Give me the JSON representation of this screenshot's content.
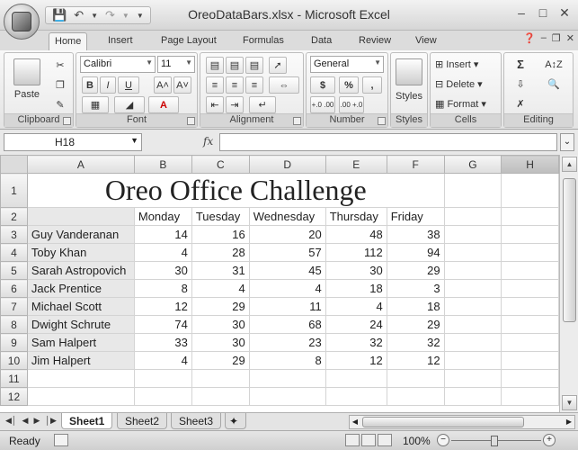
{
  "window": {
    "title": "OreoDataBars.xlsx - Microsoft Excel"
  },
  "qat": {
    "save_icon": "save-icon",
    "undo_icon": "undo-icon",
    "redo_icon": "redo-icon"
  },
  "ribbon": {
    "tabs": [
      "Home",
      "Insert",
      "Page Layout",
      "Formulas",
      "Data",
      "Review",
      "View"
    ],
    "active_tab": "Home",
    "groups": {
      "clipboard": {
        "label": "Clipboard",
        "paste": "Paste"
      },
      "font": {
        "label": "Font",
        "font_name": "Calibri",
        "font_size": "11"
      },
      "alignment": {
        "label": "Alignment"
      },
      "number": {
        "label": "Number",
        "format": "General",
        "currency": "$",
        "percent": "%",
        "comma": ",",
        "inc_dec": "+.0 .00",
        "dec_dec": ".00 +.0"
      },
      "styles": {
        "label": "Styles",
        "button": "Styles"
      },
      "cells": {
        "label": "Cells",
        "insert": "Insert",
        "delete": "Delete",
        "format": "Format"
      },
      "editing": {
        "label": "Editing",
        "sum": "Σ"
      }
    }
  },
  "formula_bar": {
    "name_box": "H18",
    "fx": "fx",
    "formula": ""
  },
  "sheet": {
    "columns": [
      "A",
      "B",
      "C",
      "D",
      "E",
      "F",
      "G",
      "H"
    ],
    "title": "Oreo Office Challenge",
    "headers": [
      "Monday",
      "Tuesday",
      "Wednesday",
      "Thursday",
      "Friday"
    ],
    "rows": [
      {
        "name": "Guy Vanderanan",
        "values": [
          14,
          16,
          20,
          48,
          38
        ]
      },
      {
        "name": "Toby Khan",
        "values": [
          4,
          28,
          57,
          112,
          94
        ]
      },
      {
        "name": "Sarah Astropovich",
        "values": [
          30,
          31,
          45,
          30,
          29
        ]
      },
      {
        "name": "Jack Prentice",
        "values": [
          8,
          4,
          4,
          18,
          3
        ]
      },
      {
        "name": "Michael Scott",
        "values": [
          12,
          29,
          11,
          4,
          18
        ]
      },
      {
        "name": "Dwight Schrute",
        "values": [
          74,
          30,
          68,
          24,
          29
        ]
      },
      {
        "name": "Sam Halpert",
        "values": [
          33,
          30,
          23,
          32,
          32
        ]
      },
      {
        "name": "Jim Halpert",
        "values": [
          4,
          29,
          8,
          12,
          12
        ]
      }
    ],
    "row_numbers": [
      "1",
      "2",
      "3",
      "4",
      "5",
      "6",
      "7",
      "8",
      "9",
      "10",
      "11",
      "12"
    ]
  },
  "sheet_tabs": [
    "Sheet1",
    "Sheet2",
    "Sheet3"
  ],
  "active_sheet": "Sheet1",
  "status": {
    "text": "Ready",
    "zoom": "100%"
  }
}
